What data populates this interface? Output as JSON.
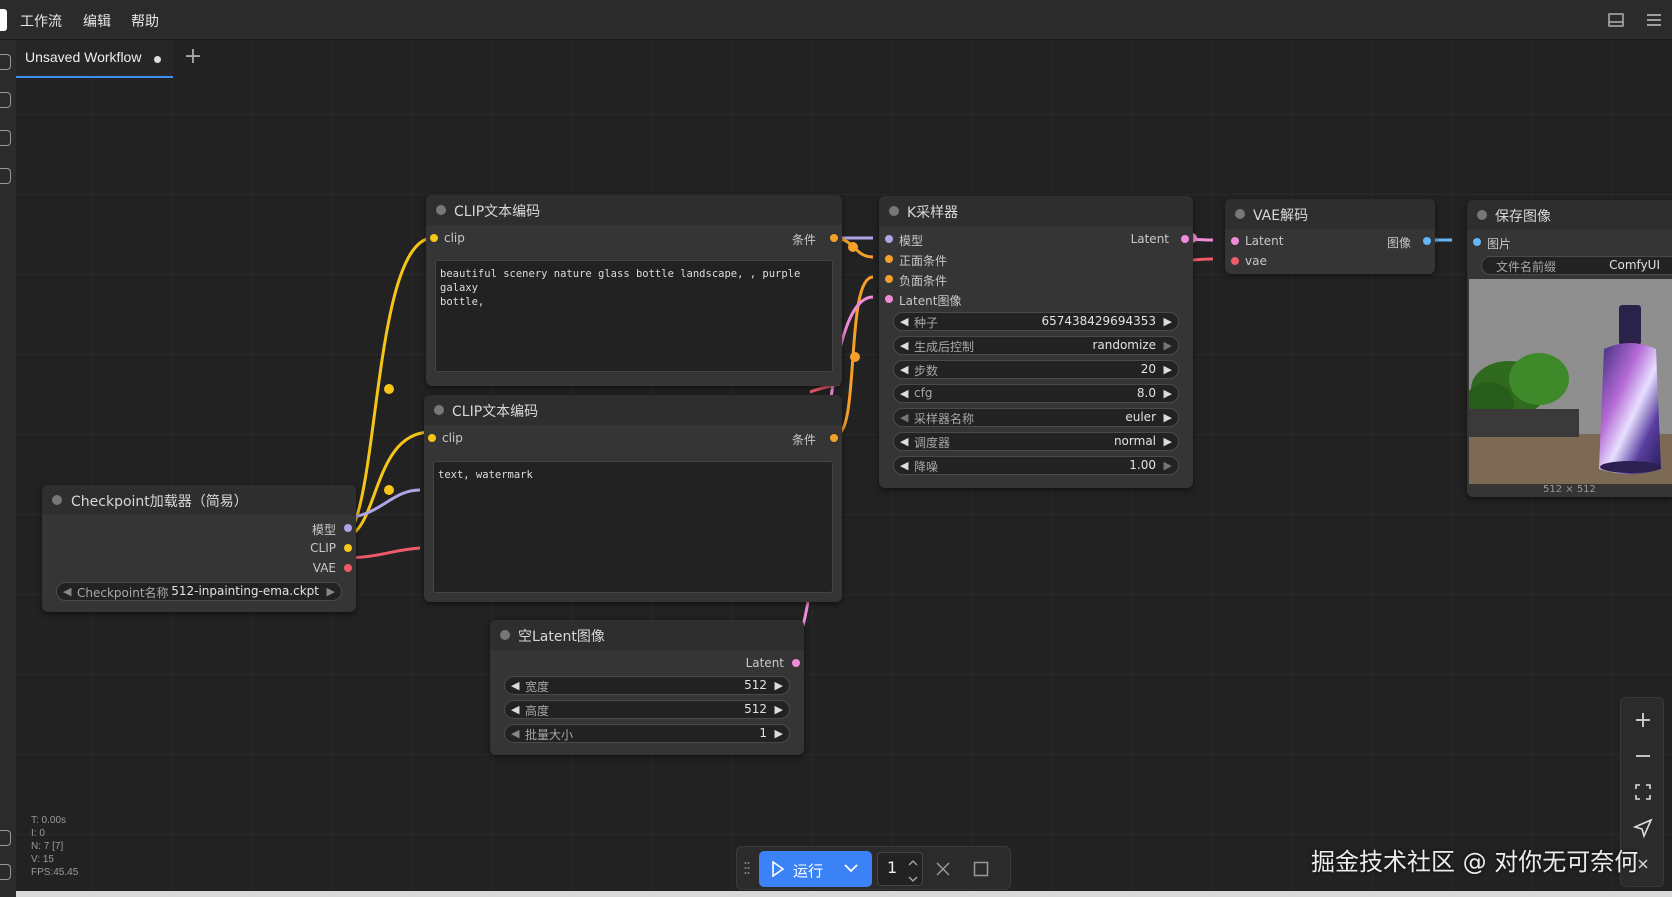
{
  "menubar": {
    "items": [
      "工作流",
      "编辑",
      "帮助"
    ]
  },
  "tabs": {
    "active_label": "Unsaved Workflow",
    "add_label": "+"
  },
  "nodes": {
    "clip_pos": {
      "title": "CLIP文本编码",
      "input": "clip",
      "output": "条件",
      "text": "beautiful scenery nature glass bottle landscape, , purple galaxy\nbottle,"
    },
    "clip_neg": {
      "title": "CLIP文本编码",
      "input": "clip",
      "output": "条件",
      "text": "text, watermark"
    },
    "ksampler": {
      "title": "K采样器",
      "inputs": [
        "模型",
        "正面条件",
        "负面条件",
        "Latent图像"
      ],
      "output": "Latent",
      "widgets": [
        {
          "label": "种子",
          "value": "657438429694353"
        },
        {
          "label": "生成后控制",
          "value": "randomize"
        },
        {
          "label": "步数",
          "value": "20"
        },
        {
          "label": "cfg",
          "value": "8.0"
        },
        {
          "label": "采样器名称",
          "value": "euler"
        },
        {
          "label": "调度器",
          "value": "normal"
        },
        {
          "label": "降噪",
          "value": "1.00"
        }
      ]
    },
    "vae_decode": {
      "title": "VAE解码",
      "inputs": [
        "Latent",
        "vae"
      ],
      "output": "图像"
    },
    "save_image": {
      "title": "保存图像",
      "input": "图片",
      "widget_label": "文件名前缀",
      "widget_value": "ComfyUI",
      "image_size": "512 × 512"
    },
    "checkpoint": {
      "title": "Checkpoint加载器（简易）",
      "outputs": [
        "模型",
        "CLIP",
        "VAE"
      ],
      "widget_label": "Checkpoint名称",
      "widget_value": "512-inpainting-ema.ckpt"
    },
    "empty_latent": {
      "title": "空Latent图像",
      "output": "Latent",
      "widgets": [
        {
          "label": "宽度",
          "value": "512"
        },
        {
          "label": "高度",
          "value": "512"
        },
        {
          "label": "批量大小",
          "value": "1"
        }
      ]
    }
  },
  "stats": {
    "t": "T: 0.00s",
    "i": "I: 0",
    "n": "N: 7 [7]",
    "v": "V: 15",
    "fps": "FPS:45.45"
  },
  "runbar": {
    "run_label": "运行",
    "queue_count": "1"
  },
  "watermark": "掘金技术社区 @ 对你无可奈何",
  "colors": {
    "clip_wire": "#f5c518",
    "model_wire": "#b0a3e6",
    "vae_wire": "#ef5b6a",
    "cond_wire": "#f5a02a",
    "latent_wire": "#f08bd8",
    "image_wire": "#64b5f6",
    "accent": "#3b82f6"
  }
}
